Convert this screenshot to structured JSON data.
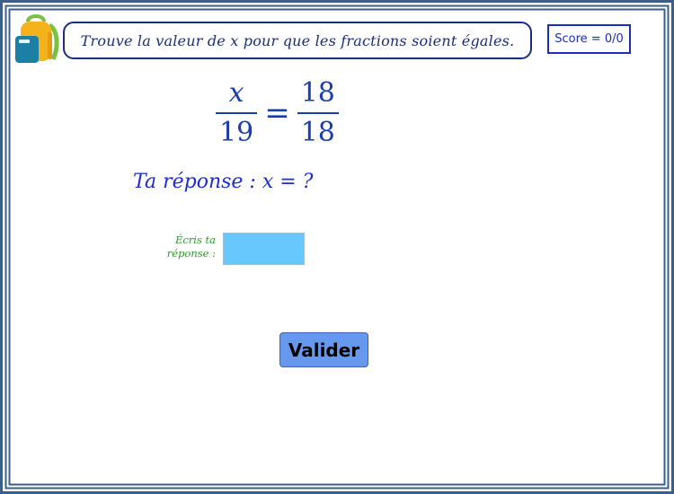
{
  "header": {
    "instruction": "Trouve la valeur de x pour que les fractions soient égales.",
    "score": "Score = 0/0"
  },
  "equation": {
    "left": {
      "numerator": "x",
      "denominator": "19"
    },
    "operator": "=",
    "right": {
      "numerator": "18",
      "denominator": "18"
    }
  },
  "answer_line": "Ta réponse : x = ?",
  "answer_field": {
    "label_line1": "Écris ta",
    "label_line2": "réponse :",
    "value": "",
    "placeholder": ""
  },
  "validate_button": "Valider",
  "icons": {
    "logo": "backpack-icon"
  },
  "colors": {
    "frame": "#3a5f8a",
    "title_text": "#1a2d80",
    "equation_text": "#1a3cb0",
    "answer_text": "#1a2dd0",
    "label_green": "#2a9a2a",
    "input_bg": "#66c8fc",
    "button_bg": "#6699ee"
  }
}
